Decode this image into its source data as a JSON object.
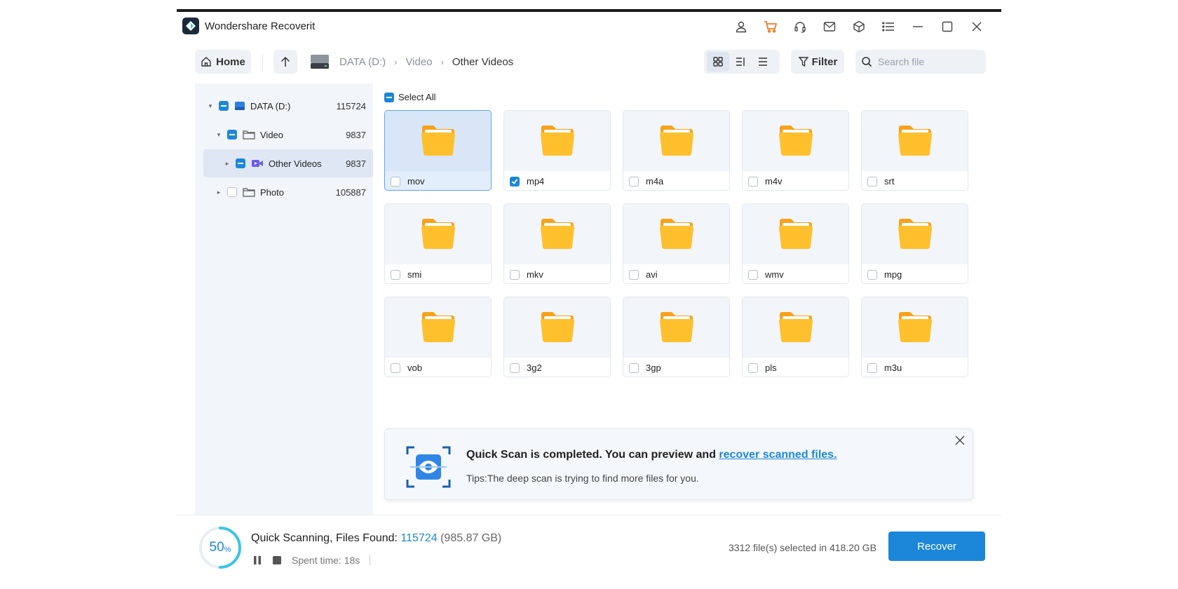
{
  "app": {
    "title": "Wondershare Recoverit"
  },
  "titlebar": {
    "icons": [
      "user-icon",
      "cart-icon",
      "headset-icon",
      "mail-icon",
      "box-icon",
      "menu-icon",
      "minimize-icon",
      "maximize-icon",
      "close-icon"
    ]
  },
  "toolbar": {
    "home_label": "Home",
    "breadcrumb": [
      "DATA (D:)",
      "Video",
      "Other Videos"
    ],
    "filter_label": "Filter",
    "search_placeholder": "Search file"
  },
  "tree": [
    {
      "label": "DATA (D:)",
      "count": "115724",
      "state": "partial",
      "expanded": true
    },
    {
      "label": "Video",
      "count": "9837",
      "state": "partial",
      "expanded": true
    },
    {
      "label": "Other Videos",
      "count": "9837",
      "state": "partial",
      "expanded": false,
      "selected": true
    },
    {
      "label": "Photo",
      "count": "105887",
      "state": "unchecked",
      "expanded": false
    }
  ],
  "content": {
    "select_all_label": "Select All",
    "folders": [
      {
        "name": "mov",
        "checked": false,
        "selected": true
      },
      {
        "name": "mp4",
        "checked": true
      },
      {
        "name": "m4a",
        "checked": false
      },
      {
        "name": "m4v",
        "checked": false
      },
      {
        "name": "srt",
        "checked": false
      },
      {
        "name": "smi",
        "checked": false
      },
      {
        "name": "mkv",
        "checked": false
      },
      {
        "name": "avi",
        "checked": false
      },
      {
        "name": "wmv",
        "checked": false
      },
      {
        "name": "mpg",
        "checked": false
      },
      {
        "name": "vob",
        "checked": false
      },
      {
        "name": "3g2",
        "checked": false
      },
      {
        "name": "3gp",
        "checked": false
      },
      {
        "name": "pls",
        "checked": false
      },
      {
        "name": "m3u",
        "checked": false
      }
    ]
  },
  "notice": {
    "title": "Quick Scan is completed. You can preview and ",
    "link": "recover scanned files.",
    "tip_label": "Tips:",
    "tip": "The deep scan is trying to find more files for you."
  },
  "scan": {
    "percent": "50",
    "percent_unit": "%",
    "progress_fraction": 0.5,
    "title": "Quick Scanning, Files Found: ",
    "files_found": "115724",
    "size": "(985.87 GB)",
    "spent": "Spent time: 18s"
  },
  "footer": {
    "selection_info": "3312 file(s) selected in 418.20 GB",
    "recover_label": "Recover"
  },
  "colors": {
    "accent": "#1c87d9",
    "folder": "#ffb31a",
    "sidebar_bg": "#f2f5f9"
  }
}
